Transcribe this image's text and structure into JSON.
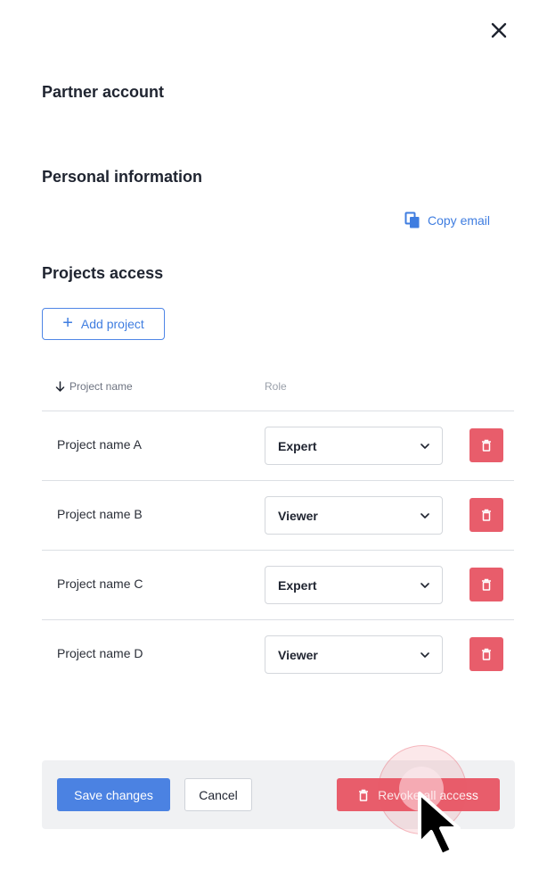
{
  "panel": {
    "partner_account_title": "Partner account",
    "personal_info_title": "Personal information",
    "copy_email_label": "Copy email",
    "projects_access_title": "Projects access",
    "add_project_label": "Add project"
  },
  "table": {
    "headers": {
      "project_name": "Project name",
      "role": "Role"
    },
    "rows": [
      {
        "project": "Project name A",
        "role": "Expert"
      },
      {
        "project": "Project name B",
        "role": "Viewer"
      },
      {
        "project": "Project name C",
        "role": "Expert"
      },
      {
        "project": "Project name D",
        "role": "Viewer"
      }
    ]
  },
  "footer": {
    "save_label": "Save changes",
    "cancel_label": "Cancel",
    "revoke_label": "Revoke all access"
  },
  "icons": {
    "close": "close-icon",
    "copy": "copy-icon",
    "plus": "plus-icon",
    "sort": "arrow-down-icon",
    "chevron": "chevron-down-icon",
    "trash": "trash-icon",
    "cursor": "mouse-pointer-icon"
  },
  "colors": {
    "primary": "#4b82e2",
    "link": "#3f7de0",
    "danger": "#e85d6b",
    "text": "#1f2430",
    "footer_bg": "#f0f1f3"
  }
}
